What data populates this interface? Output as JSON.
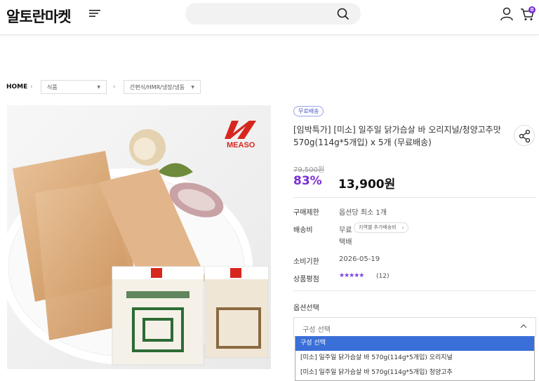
{
  "header": {
    "logo": "알토란마켓",
    "cart_count": "0"
  },
  "breadcrumb": {
    "home": "HOME",
    "category1": "식품",
    "category2": "간편식/HMR/냉장/냉동"
  },
  "product": {
    "badge": "무료배송",
    "title": "[임박특가] [미소] 일주일 닭가슴살 바 오리지널/청양고추맛 570g(114g*5개입) x 5개 (무료배송)",
    "original_price": "79,500원",
    "discount": "83%",
    "price": "13,900원",
    "brand_logo_text": "MEASO"
  },
  "info": {
    "limit_label": "구매제한",
    "limit_value": "옵션당 최소 1개",
    "shipping_label": "배송비",
    "shipping_value": "무료",
    "shipping_region": "지역별 추가배송비",
    "shipping_method": "택배",
    "expiry_label": "소비기한",
    "expiry_value": "2026-05-19",
    "rating_label": "상품평점",
    "stars": "★★★★★",
    "review_count": "(12)"
  },
  "options": {
    "label": "옵션선택",
    "select_placeholder": "구성 선택",
    "items": [
      "구성 선택",
      "[미소] 일주일 닭가슴살 바 570g(114g*5개입) 오리지널",
      "[미소] 일주일 닭가슴살 바 570g(114g*5개입) 청양고추"
    ]
  },
  "colors": {
    "accent_purple": "#7a2fd4",
    "dropdown_highlight": "#3b6fd8"
  }
}
